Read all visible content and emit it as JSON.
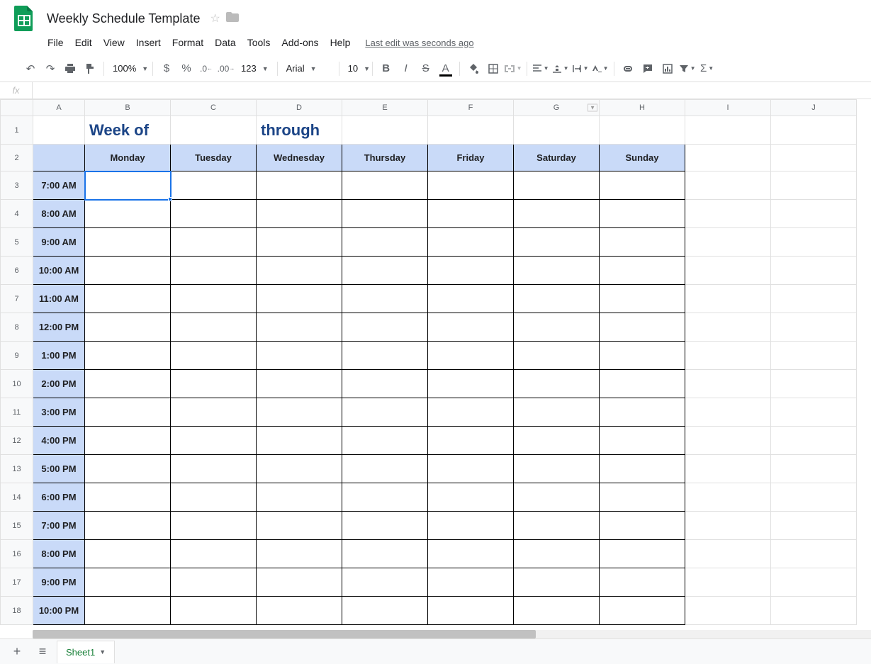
{
  "doc": {
    "title": "Weekly Schedule Template"
  },
  "menus": [
    "File",
    "Edit",
    "View",
    "Insert",
    "Format",
    "Data",
    "Tools",
    "Add-ons",
    "Help"
  ],
  "last_edit": "Last edit was seconds ago",
  "toolbar": {
    "zoom": "100%",
    "font": "Arial",
    "font_size": "10",
    "num_format": "123"
  },
  "formula_bar": {
    "fx": "fx",
    "value": ""
  },
  "columns": [
    "A",
    "B",
    "C",
    "D",
    "E",
    "F",
    "G",
    "H",
    "I",
    "J"
  ],
  "header_row": {
    "week_of": "Week of",
    "through": "through"
  },
  "days": [
    "Monday",
    "Tuesday",
    "Wednesday",
    "Thursday",
    "Friday",
    "Saturday",
    "Sunday"
  ],
  "times": [
    "7:00 AM",
    "8:00 AM",
    "9:00 AM",
    "10:00 AM",
    "11:00 AM",
    "12:00 PM",
    "1:00 PM",
    "2:00 PM",
    "3:00 PM",
    "4:00 PM",
    "5:00 PM",
    "6:00 PM",
    "7:00 PM",
    "8:00 PM",
    "9:00 PM",
    "10:00 PM"
  ],
  "selected_cell": "B3",
  "sheet_tab": "Sheet1"
}
